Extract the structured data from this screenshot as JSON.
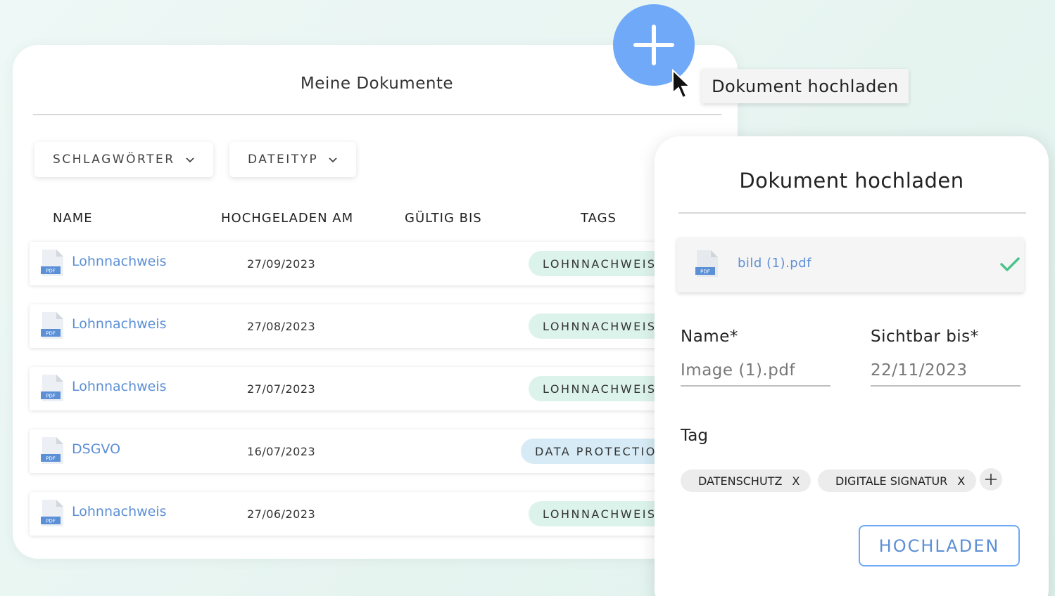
{
  "documents": {
    "title": "Meine Dokumente",
    "filters": [
      {
        "label": "SCHLAGWÖRTER",
        "icon": "chevron-down-icon"
      },
      {
        "label": "DATEITYP",
        "icon": "chevron-down-icon"
      }
    ],
    "columns": [
      "NAME",
      "HOCHGELADEN AM",
      "GÜLTIG BIS",
      "TAGS"
    ],
    "rows": [
      {
        "name": "Lohnnachweis",
        "uploaded": "27/09/2023",
        "valid_until": "",
        "tag": "LOHNNACHWEIS",
        "tag_color": "#dcf3ec"
      },
      {
        "name": "Lohnnachweis",
        "uploaded": "27/08/2023",
        "valid_until": "",
        "tag": "LOHNNACHWEIS",
        "tag_color": "#dcf3ec"
      },
      {
        "name": "Lohnnachweis",
        "uploaded": "27/07/2023",
        "valid_until": "",
        "tag": "LOHNNACHWEIS",
        "tag_color": "#dcf3ec"
      },
      {
        "name": "DSGVO",
        "uploaded": "16/07/2023",
        "valid_until": "",
        "tag": "DATA PROTECTION",
        "tag_color": "#d6ebf5"
      },
      {
        "name": "Lohnnachweis",
        "uploaded": "27/06/2023",
        "valid_until": "",
        "tag": "LOHNNACHWEIS",
        "tag_color": "#dcf3ec"
      }
    ],
    "file_icon_label": "PDF"
  },
  "fab": {
    "icon": "plus-icon",
    "color": "#6fa9f7"
  },
  "tooltip": {
    "text": "Dokument hochladen"
  },
  "upload": {
    "title": "Dokument hochladen",
    "file": {
      "name": "bild (1).pdf",
      "status_icon": "check-icon",
      "status_color": "#4cc38a"
    },
    "name_label": "Name*",
    "name_value": "Image (1).pdf",
    "visible_label": "Sichtbar bis*",
    "visible_value": "22/11/2023",
    "tag_label": "Tag",
    "tags": [
      {
        "label": "DATENSCHUTZ",
        "remove": "X"
      },
      {
        "label": "DIGITALE SIGNATUR",
        "remove": "X"
      }
    ],
    "add_tag_icon": "plus-icon",
    "submit_label": "HOCHLADEN"
  },
  "colors": {
    "accent": "#6fa9f7",
    "link": "#5c8fd6"
  }
}
